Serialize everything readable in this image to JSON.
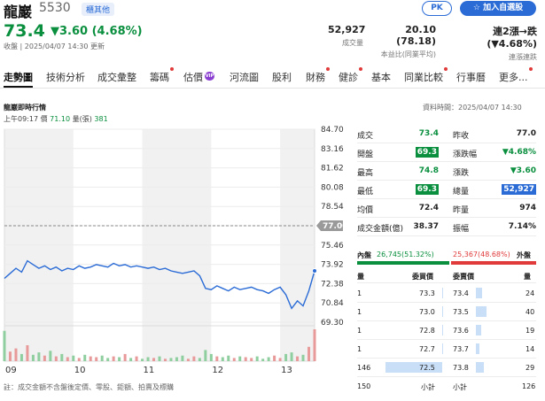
{
  "header": {
    "name": "龍巖",
    "code": "5530",
    "tag": "櫃其他",
    "price": "73.4",
    "change": "▼3.60 (4.68%)",
    "info": "收盤 | 2025/04/07 14:30 更新",
    "volume_value": "52,927",
    "volume_label": "成交量",
    "pe_value": "20.10 (78.18)",
    "pe_label": "本益比(同業平均)",
    "streak_value": "連2漲→跌 (▼4.68%)",
    "streak_label": "連漲連跌",
    "pk_label": "PK",
    "watch_label": "加入自選股",
    "colors": {
      "down": "#0a8f3f",
      "up": "#e03a3a",
      "accent": "#2a6bd6"
    }
  },
  "tabs": [
    {
      "label": "走勢圖",
      "active": true,
      "dot": false
    },
    {
      "label": "技術分析",
      "active": false,
      "dot": false
    },
    {
      "label": "成交彙整",
      "active": false,
      "dot": false
    },
    {
      "label": "籌碼",
      "active": false,
      "dot": true
    },
    {
      "label": "估價",
      "active": false,
      "dot": false,
      "vip": "VIP"
    },
    {
      "label": "河流圖",
      "active": false,
      "dot": false
    },
    {
      "label": "股利",
      "active": false,
      "dot": false
    },
    {
      "label": "財務",
      "active": false,
      "dot": true
    },
    {
      "label": "健診",
      "active": false,
      "dot": true
    },
    {
      "label": "基本",
      "active": false,
      "dot": false
    },
    {
      "label": "同業比較",
      "active": false,
      "dot": true
    },
    {
      "label": "行事曆",
      "active": false,
      "dot": false
    },
    {
      "label": "更多...",
      "active": false,
      "dot": true
    }
  ],
  "chart_section": {
    "title": "龍巖即時行情",
    "date": "資料時間：2025/04/07 14:30",
    "legend_time": "上午09:17",
    "legend_price_label": "價",
    "legend_price": "71.10",
    "legend_vol_label": "量(張)",
    "legend_vol": "381"
  },
  "chart_data": {
    "type": "line",
    "ylim": [
      69.3,
      84.7
    ],
    "yticks": [
      "84.70",
      "83.16",
      "81.62",
      "80.08",
      "78.54",
      "77.00",
      "75.46",
      "73.92",
      "72.38",
      "70.84",
      "69.30"
    ],
    "reference": 77.0,
    "reference_label": "77.00",
    "xticks": [
      "09",
      "10",
      "11",
      "12",
      "13"
    ],
    "x": [
      0,
      5,
      10,
      15,
      20,
      25,
      30,
      35,
      40,
      45,
      50,
      55,
      60,
      65,
      70,
      75,
      80,
      85,
      90,
      95,
      100,
      105,
      110,
      115,
      120,
      125,
      130,
      135,
      140,
      145,
      150,
      155,
      160,
      165,
      170,
      175,
      180,
      185,
      190,
      195,
      200,
      205,
      210,
      215,
      220,
      225,
      230,
      235,
      240,
      245,
      250,
      255,
      260,
      265,
      270
    ],
    "y": [
      72.8,
      73.2,
      73.6,
      73.3,
      74.2,
      73.9,
      73.6,
      73.8,
      73.5,
      73.7,
      73.4,
      73.6,
      73.5,
      73.8,
      73.6,
      73.7,
      73.9,
      73.8,
      73.7,
      74.0,
      73.8,
      73.9,
      73.7,
      73.8,
      73.7,
      73.6,
      73.7,
      73.5,
      73.6,
      73.4,
      73.3,
      73.2,
      73.3,
      73.4,
      73.0,
      72.0,
      71.9,
      72.2,
      72.0,
      71.8,
      72.1,
      71.9,
      72.0,
      72.1,
      71.9,
      71.8,
      71.6,
      71.9,
      72.1,
      71.5,
      70.4,
      71.0,
      70.6,
      71.8,
      73.4
    ],
    "volume": [
      381,
      120,
      160,
      90,
      200,
      80,
      110,
      70,
      130,
      60,
      90,
      50,
      70,
      40,
      80,
      60,
      50,
      70,
      40,
      60,
      50,
      90,
      40,
      60,
      30,
      50,
      40,
      60,
      30,
      40,
      50,
      70,
      30,
      60,
      40,
      140,
      90,
      60,
      50,
      70,
      40,
      60,
      50,
      40,
      60,
      30,
      50,
      70,
      40,
      90,
      110,
      60,
      80,
      180,
      400
    ],
    "series": [
      {
        "values": []
      }
    ]
  },
  "quote": {
    "rows": [
      {
        "l": "成交",
        "v": "73.4",
        "vc": "down",
        "l2": "昨收",
        "v2": "77.0",
        "v2c": "normal"
      },
      {
        "l": "開盤",
        "v": "69.3",
        "vc": "hl",
        "l2": "漲跌幅",
        "v2": "▼4.68%",
        "v2c": "down"
      },
      {
        "l": "最高",
        "v": "74.8",
        "vc": "down",
        "l2": "漲跌",
        "v2": "▼3.60",
        "v2c": "down"
      },
      {
        "l": "最低",
        "v": "69.3",
        "vc": "hl",
        "l2": "總量",
        "v2": "52,927",
        "v2c": "hlb"
      },
      {
        "l": "均價",
        "v": "72.4",
        "vc": "normal",
        "l2": "昨量",
        "v2": "974",
        "v2c": "normal"
      },
      {
        "l": "成交金額(億)",
        "v": "38.37",
        "vc": "normal",
        "l2": "振幅",
        "v2": "7.14%",
        "v2c": "normal"
      }
    ]
  },
  "inout": {
    "in_label": "內盤",
    "in_value": "26,745(51.32%)",
    "out_value": "25,367(48.68%)",
    "out_label": "外盤",
    "in_ratio": 0.5132
  },
  "book": {
    "h_qty": "量",
    "h_bid": "委買價",
    "h_ask": "委賣價",
    "h_qty2": "量",
    "rows": [
      {
        "bq": "1",
        "bp": "73.3",
        "ap": "73.4",
        "aq": "24",
        "bqn": 1,
        "aqn": 24
      },
      {
        "bq": "1",
        "bp": "73.0",
        "ap": "73.5",
        "aq": "40",
        "bqn": 1,
        "aqn": 40
      },
      {
        "bq": "1",
        "bp": "72.8",
        "ap": "73.6",
        "aq": "19",
        "bqn": 1,
        "aqn": 19
      },
      {
        "bq": "1",
        "bp": "72.7",
        "ap": "73.7",
        "aq": "14",
        "bqn": 1,
        "aqn": 14
      },
      {
        "bq": "146",
        "bp": "72.5",
        "ap": "73.8",
        "aq": "29",
        "bqn": 146,
        "aqn": 29
      }
    ],
    "total_bid": "150",
    "total_bid_label": "小計",
    "total_ask_label": "小計",
    "total_ask": "126"
  },
  "footer": {
    "note": "註：成交金額不含盤後定價、零股、鉅額、拍賣及標購"
  }
}
